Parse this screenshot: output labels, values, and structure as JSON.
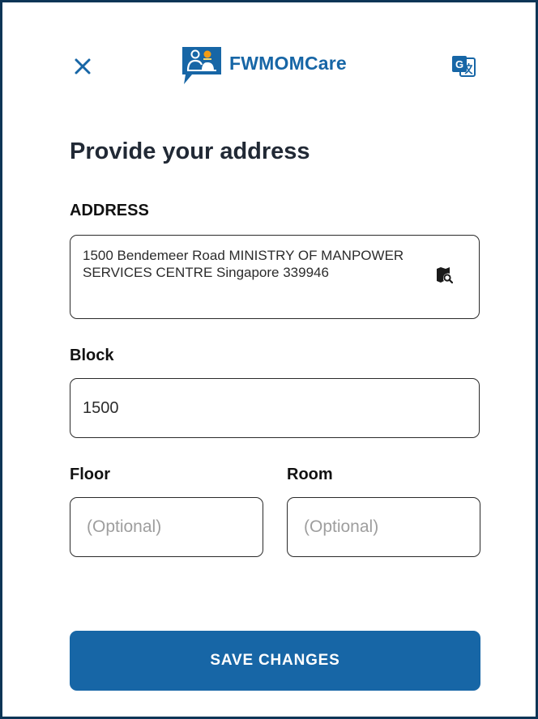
{
  "header": {
    "brand_name": "FWMOMCare",
    "brand_color": "#1766a6"
  },
  "page": {
    "title": "Provide your address"
  },
  "address": {
    "label": "ADDRESS",
    "value": "1500 Bendemeer Road MINISTRY OF MANPOWER SERVICES CENTRE Singapore 339946",
    "icon": "map-search-icon"
  },
  "block": {
    "label": "Block",
    "value": "1500"
  },
  "floor": {
    "label": "Floor",
    "value": "",
    "placeholder": "(Optional)"
  },
  "room": {
    "label": "Room",
    "value": "",
    "placeholder": "(Optional)"
  },
  "actions": {
    "save_label": "SAVE CHANGES"
  },
  "colors": {
    "frame_border": "#0d3556",
    "primary": "#1766a6",
    "title_text": "#212935",
    "placeholder": "#9e9e9e"
  }
}
